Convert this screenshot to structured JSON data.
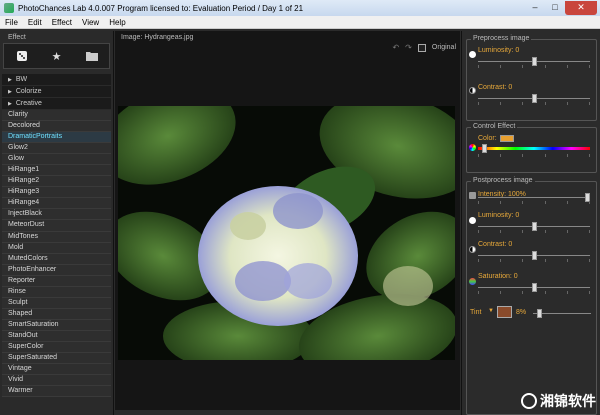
{
  "window": {
    "title": "PhotoChances Lab 4.0.007   Program licensed to: Evaluation Period / Day 1 of 21",
    "minimize": "–",
    "maximize": "□",
    "close": "✕"
  },
  "menu": [
    "File",
    "Edit",
    "Effect",
    "View",
    "Help"
  ],
  "left": {
    "title": "Effect",
    "tools": [
      "dice-icon",
      "star-icon",
      "folder-icon"
    ],
    "categories": [
      "BW",
      "Colorize",
      "Creative"
    ],
    "effects": [
      "Clarity",
      "Decolored",
      "DramaticPortraits",
      "Glow2",
      "Glow",
      "HiRange1",
      "HiRange2",
      "HiRange3",
      "HiRange4",
      "InjectBlack",
      "MeteorDust",
      "MidTones",
      "Mold",
      "MutedColors",
      "PhotoEnhancer",
      "Reporter",
      "Rinse",
      "Sculpt",
      "Shaped",
      "SmartSaturation",
      "StandOut",
      "SuperColor",
      "SuperSaturated",
      "Vintage",
      "Vivid",
      "Warmer"
    ],
    "selected_effect": "DramaticPortraits"
  },
  "center": {
    "image_title": "Image: Hydrangeas.jpg",
    "original_label": "Original"
  },
  "right": {
    "preprocess_title": "Preprocess image",
    "luminosity_label": "Luminosity: 0",
    "contrast_label": "Contrast: 0",
    "control_title": "Control Effect",
    "color_label": "Color:",
    "postprocess_title": "Postprocess image",
    "intensity_label": "Intensity: 100%",
    "post_luminosity_label": "Luminosity: 0",
    "post_contrast_label": "Contrast: 0",
    "saturation_label": "Saturation: 0",
    "tint_label": "Tint",
    "tint_value": "8%"
  },
  "watermark": "湘锦软件",
  "colors": {
    "accent_orange": "#e8a93a",
    "selected_cyan": "#6fe0ff",
    "tint": "#8a4b2b",
    "color_swatch": "#e8a030"
  }
}
